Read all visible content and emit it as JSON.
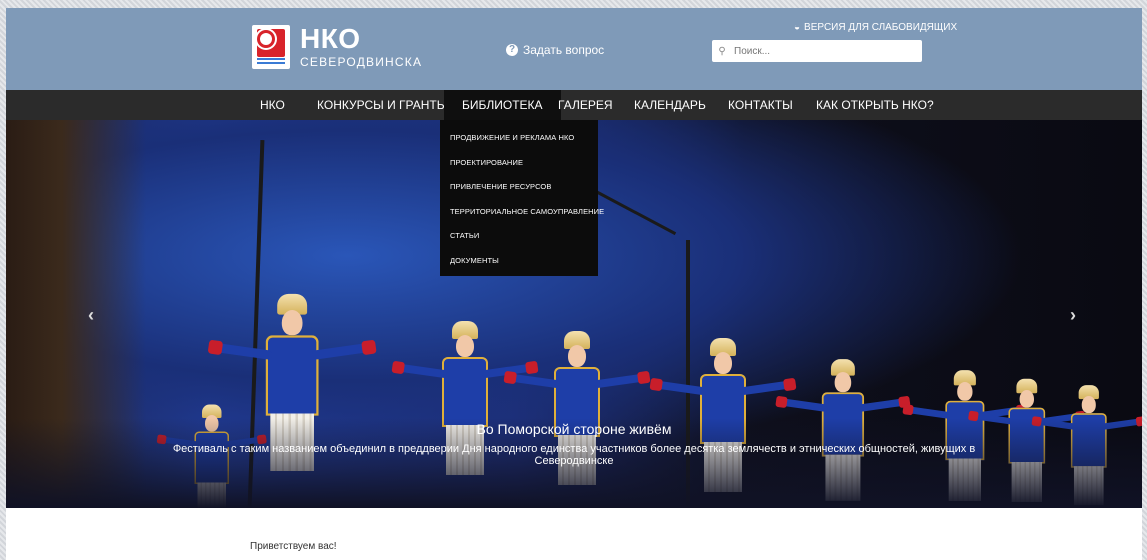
{
  "header": {
    "logo_title": "НКО",
    "logo_subtitle": "СЕВЕРОДВИНСКА",
    "ask_label": "Задать вопрос",
    "accessible_label": "ВЕРСИЯ ДЛЯ СЛАБОВИДЯЩИХ",
    "search_placeholder": "Поиск..."
  },
  "nav": {
    "items": [
      {
        "label": "НКО"
      },
      {
        "label": "КОНКУРСЫ И ГРАНТЫ"
      },
      {
        "label": "БИБЛИОТЕКА"
      },
      {
        "label": "ГАЛЕРЕЯ"
      },
      {
        "label": "КАЛЕНДАРЬ"
      },
      {
        "label": "КОНТАКТЫ"
      },
      {
        "label": "КАК ОТКРЫТЬ НКО?"
      }
    ],
    "active_index": 2
  },
  "dropdown": {
    "items": [
      {
        "label": "ПРОДВИЖЕНИЕ И РЕКЛАМА НКО"
      },
      {
        "label": "ПРОЕКТИРОВАНИЕ"
      },
      {
        "label": "ПРИВЛЕЧЕНИЕ РЕСУРСОВ"
      },
      {
        "label": "ТЕРРИТОРИАЛЬНОЕ САМОУПРАВЛЕНИЕ"
      },
      {
        "label": "СТАТЬИ"
      },
      {
        "label": "ДОКУМЕНТЫ"
      }
    ]
  },
  "slider": {
    "title": "Во Поморской стороне живём",
    "text": "Фестиваль с таким названием объединил в преддверии Дня народного единства участников более десятка землячеств и этнических общностей, живущих в Северодвинске",
    "prev_icon": "‹",
    "next_icon": "›"
  },
  "main": {
    "welcome": "Приветствуем вас!"
  },
  "colors": {
    "header_bg": "#7f9ab8",
    "nav_bg": "#2b2b2b",
    "dropdown_bg": "#0c0c0c"
  }
}
